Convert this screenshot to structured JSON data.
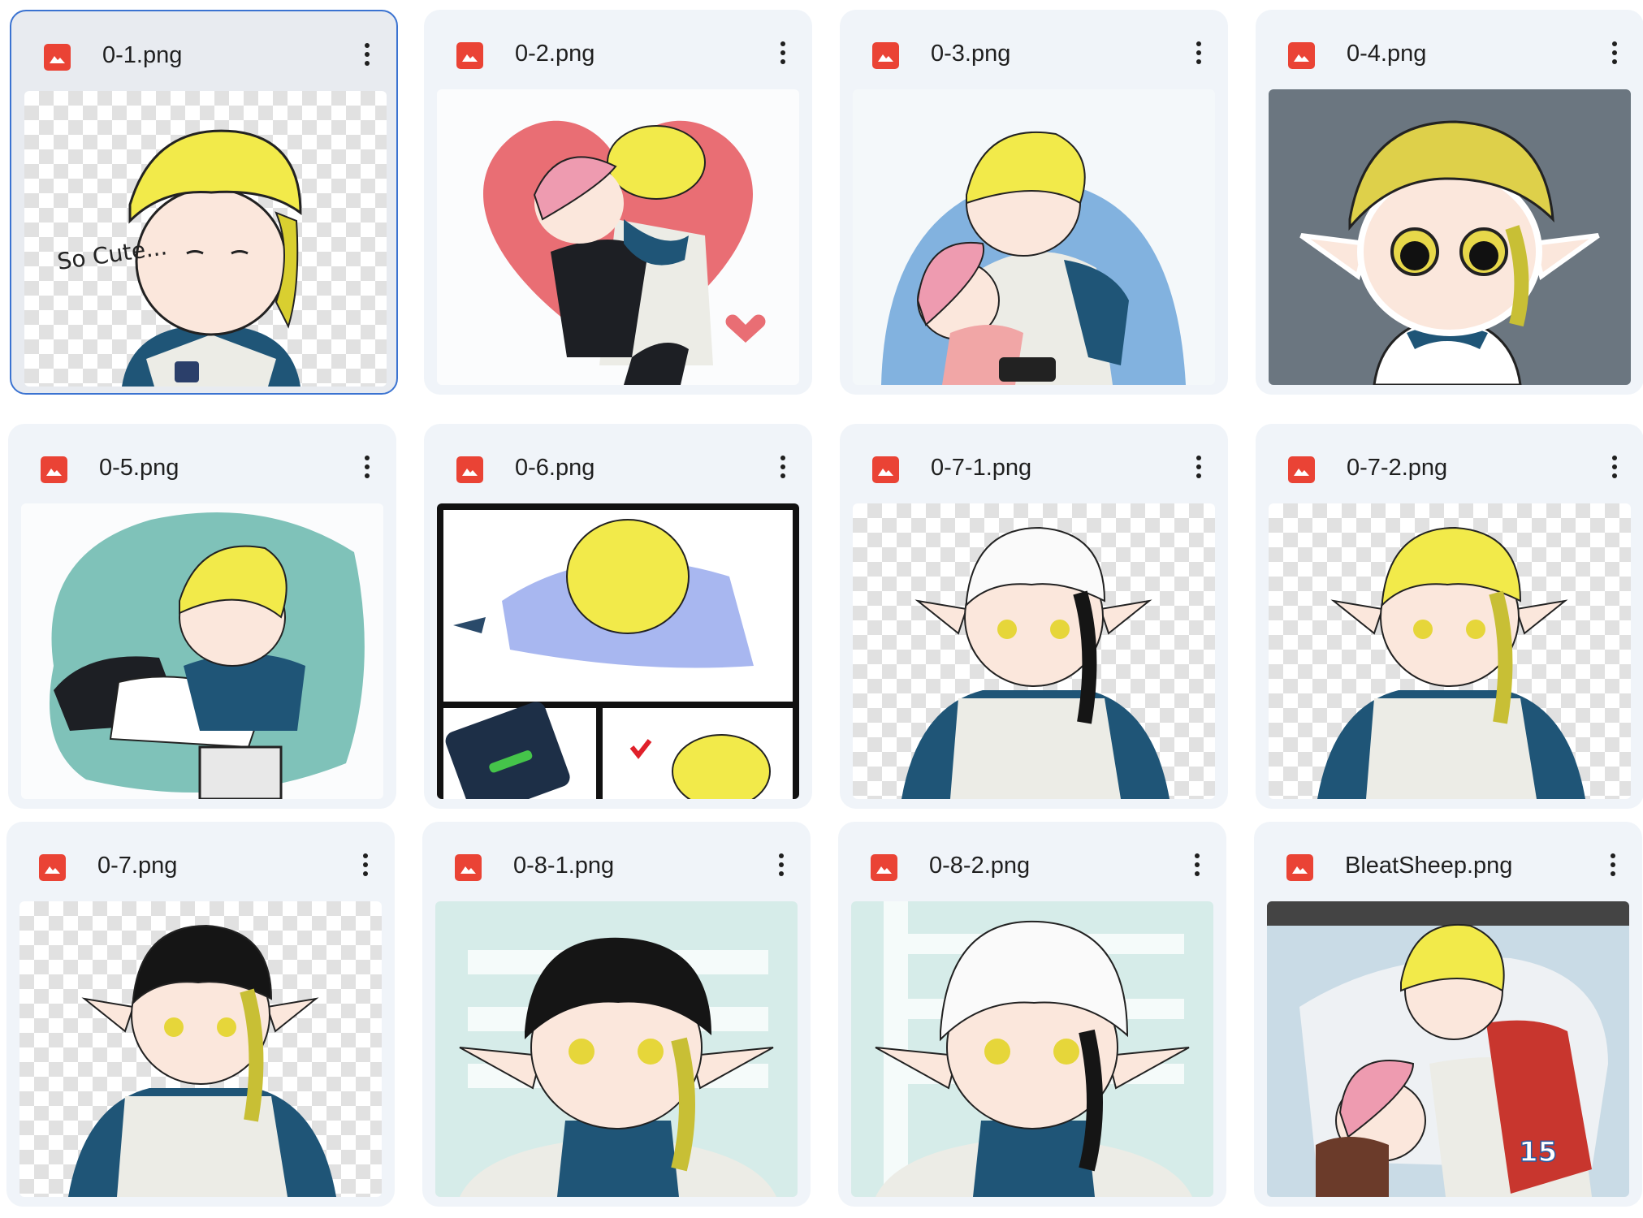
{
  "files": [
    {
      "name": "0-1.png"
    },
    {
      "name": "0-2.png"
    },
    {
      "name": "0-3.png"
    },
    {
      "name": "0-4.png"
    },
    {
      "name": "0-5.png"
    },
    {
      "name": "0-6.png"
    },
    {
      "name": "0-7-1.png"
    },
    {
      "name": "0-7-2.png"
    },
    {
      "name": "0-7.png"
    },
    {
      "name": "0-8-1.png"
    },
    {
      "name": "0-8-2.png"
    },
    {
      "name": "BleatSheep.png"
    }
  ],
  "thumb_text": {
    "so_cute": "So Cute...",
    "jersey_number": "15"
  },
  "colors": {
    "image_icon": "#ea4335",
    "card_bg": "#f0f4f9",
    "selected_border": "#3b73d1",
    "hair_blond": "#f2ea4a",
    "hair_black": "#151515",
    "hair_white": "#fafafa",
    "hair_pink": "#ee9bb0",
    "scarf": "#1f5577"
  },
  "icons": {
    "file_type": "image-icon",
    "menu": "more-vert-icon"
  }
}
